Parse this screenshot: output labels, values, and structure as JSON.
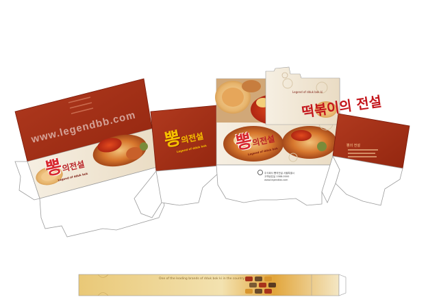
{
  "watermark": "www.legendbb.com",
  "logo": {
    "main": "뽕",
    "secondary": "의전설",
    "sub": "Legend of dduk bok"
  },
  "right_logo": {
    "main": "떡볶이의 전설",
    "sub": "Legend of dduk bok ki"
  },
  "back_panel_title": "뽕의 전설",
  "info_text_lines": [
    "주식회사 뽕의전설 서울특별시",
    "고객상담실 1588-0000",
    "www.legendbb.com"
  ],
  "strip_tagline": "One of the leading brands of dduk bok ki in the country",
  "colors": {
    "panel_red": "#a8331b",
    "panel_red_dark": "#8e2512",
    "paper": "#f3ece0",
    "gold": "#e7c46d"
  }
}
